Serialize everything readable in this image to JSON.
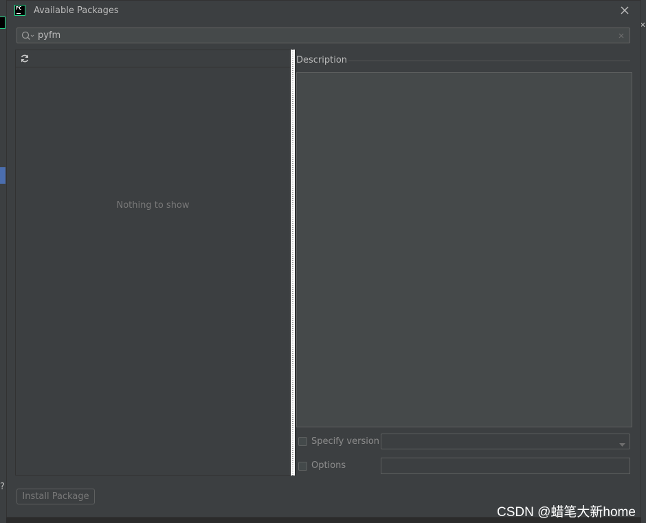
{
  "dialog": {
    "title": "Available Packages",
    "app_icon_text": "PC"
  },
  "search": {
    "value": "pyfm"
  },
  "package_list": {
    "empty_text": "Nothing to show"
  },
  "description": {
    "label": "Description"
  },
  "options": {
    "specify_version_label": "Specify version",
    "specify_version_checked": false,
    "options_label": "Options",
    "options_checked": false,
    "options_value": ""
  },
  "footer": {
    "install_label": "Install Package"
  },
  "watermark": "CSDN @蜡笔大新home",
  "icons": {
    "app": "pycharm-icon",
    "close": "close-icon",
    "search": "search-icon",
    "clear": "clear-icon",
    "refresh": "refresh-icon",
    "dropdown": "chevron-down-icon"
  },
  "colors": {
    "dialog_bg": "#3c3f41",
    "field_bg": "#45494a",
    "text": "#bbbbbb",
    "muted_text": "#787878",
    "accent_green": "#21d789"
  }
}
